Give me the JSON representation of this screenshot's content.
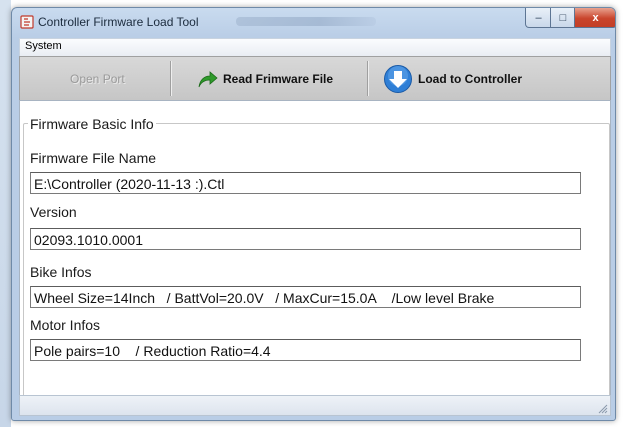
{
  "window": {
    "title": "Controller Firmware Load Tool",
    "controls": {
      "minimize": "–",
      "maximize": "□",
      "close": "x"
    }
  },
  "menu": {
    "items": [
      "System"
    ]
  },
  "toolbar": {
    "open_port": "Open Port",
    "read_firmware": "Read Frimware File",
    "load_controller": "Load to Controller"
  },
  "group": {
    "title": "Firmware Basic Info",
    "fields": [
      {
        "label": "Firmware File Name",
        "value": "E:\\Controller (2020-11-13 :).Ctl"
      },
      {
        "label": "Version",
        "value": "02093.1010.0001"
      },
      {
        "label": "Bike Infos",
        "value": "Wheel Size=14Inch   / BattVol=20.0V   / MaxCur=15.0A    /Low level Brake"
      },
      {
        "label": "Motor Infos",
        "value": "Pole pairs=10    / Reduction Ratio=4.4"
      }
    ]
  },
  "icons": {
    "app": "app-icon",
    "read": "green-arrow-icon",
    "load": "blue-down-arrow-icon"
  },
  "colors": {
    "accent_green": "#2f9a2b",
    "accent_blue": "#2f7fd6",
    "close_red": "#c9452c"
  }
}
